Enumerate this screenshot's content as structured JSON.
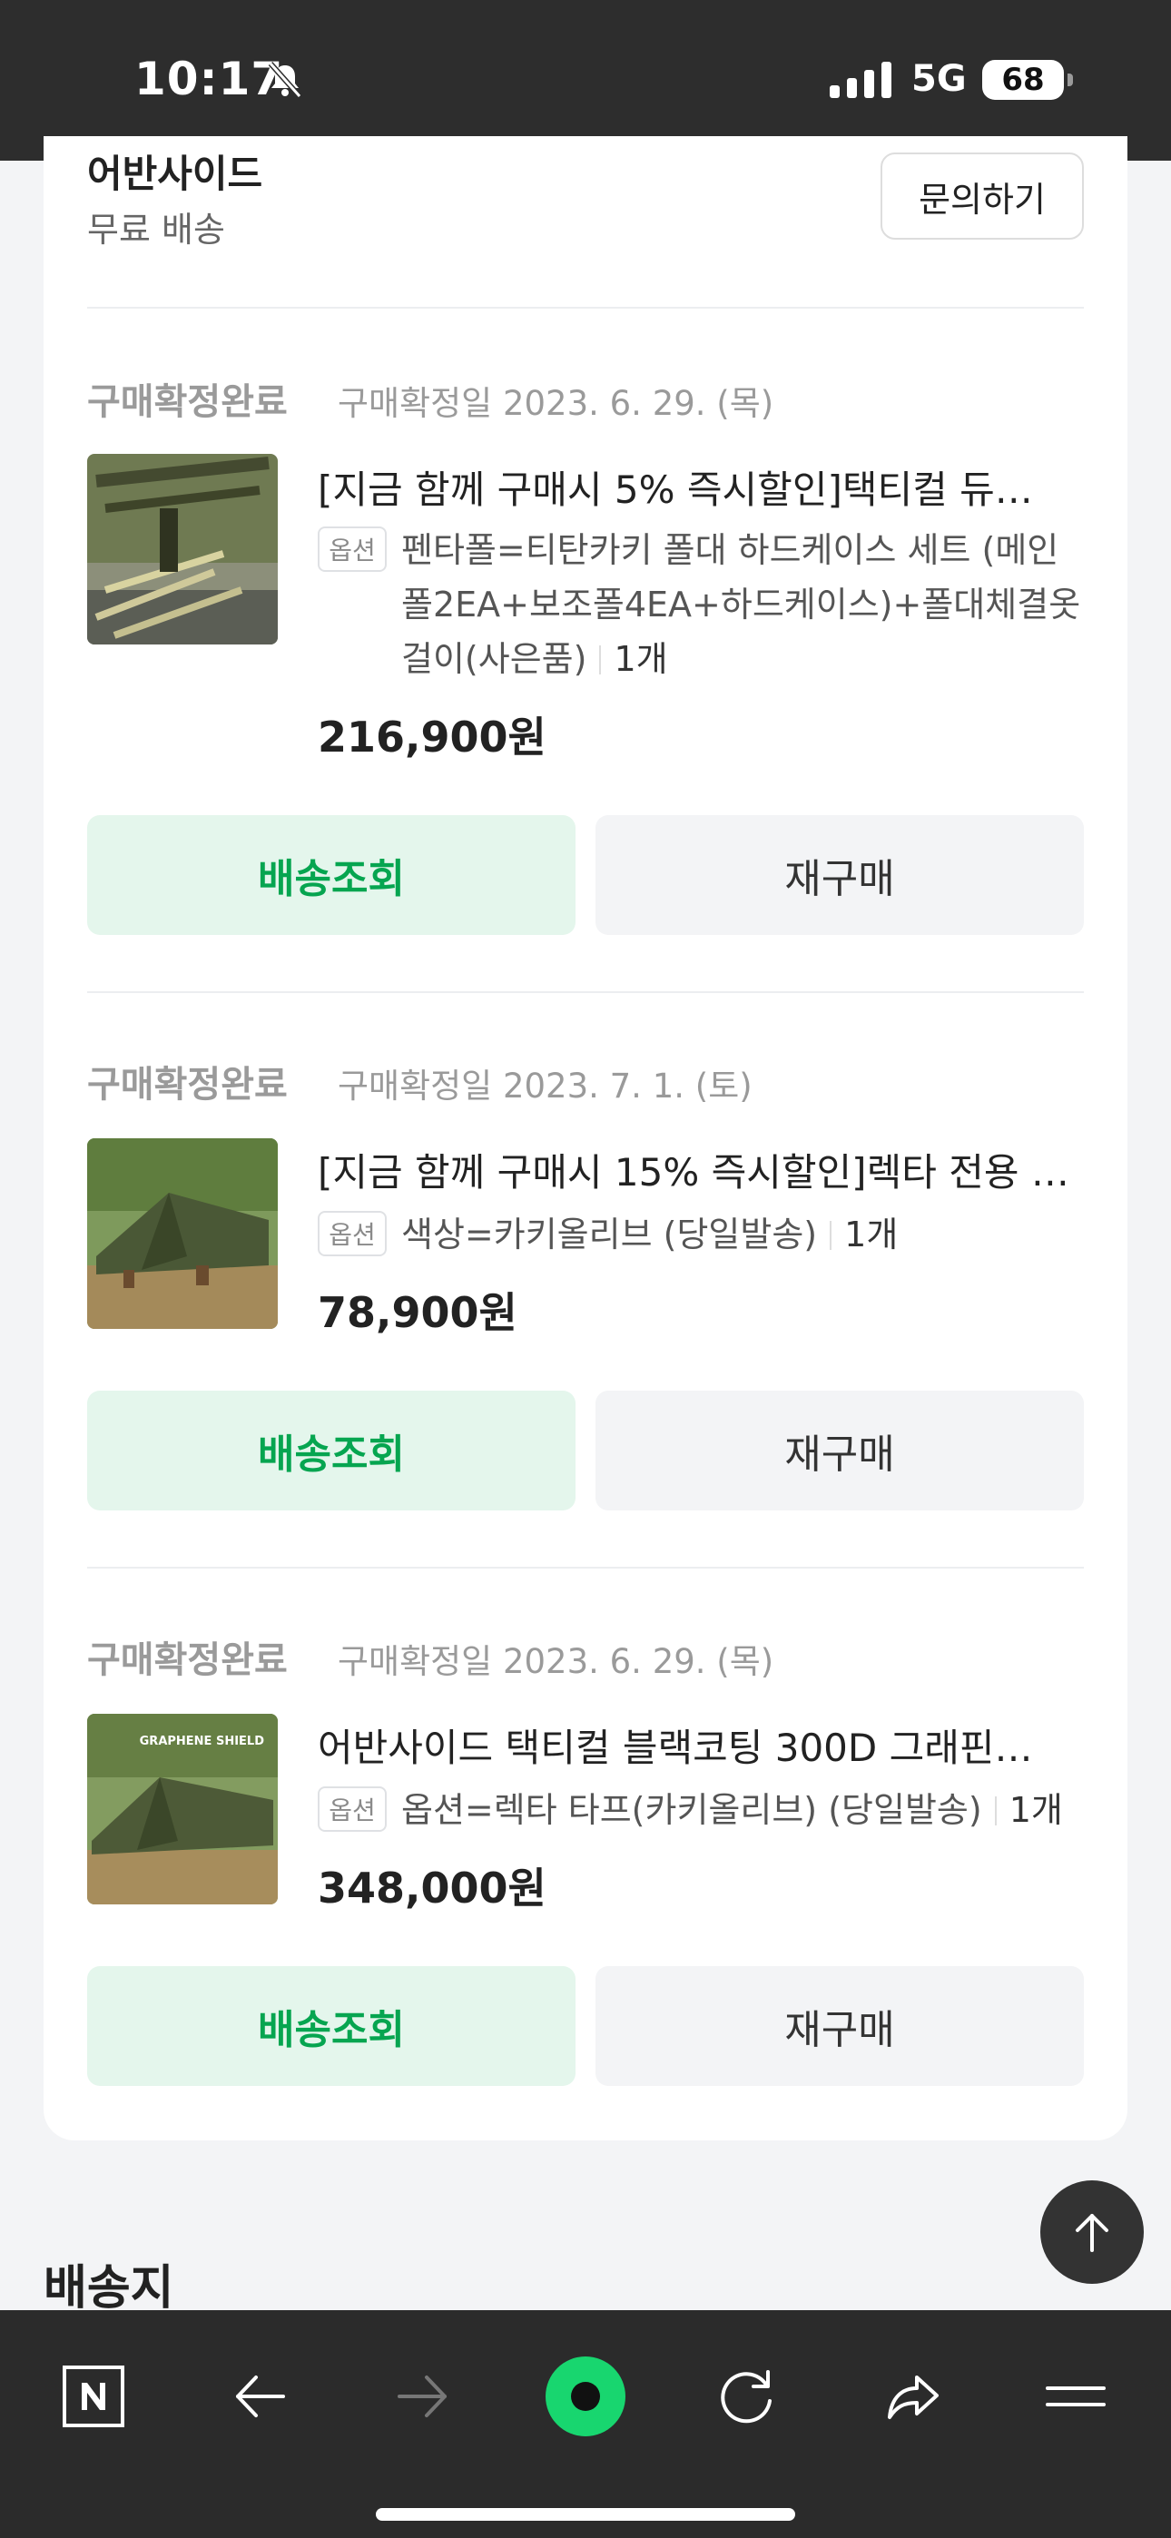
{
  "status_bar": {
    "time": "10:17",
    "network": "5G",
    "battery": "68"
  },
  "seller": {
    "name": "어반사이드",
    "shipping": "무료 배송",
    "inquiry_label": "문의하기"
  },
  "orders": [
    {
      "status": "구매확정완료",
      "date": "구매확정일 2023. 6. 29. (목)",
      "title": "[지금 함께 구매시 5% 즉시할인]택티컬 듀…",
      "option_badge": "옵션",
      "option": "펜타폴=티탄카키 폴대 하드케이스 세트 (메인폴2EA+보조폴4EA+하드케이스)+폴대체결옷걸이(사은품)",
      "quantity": "1개",
      "price": "216,900원",
      "track_label": "배송조회",
      "rebuy_label": "재구매"
    },
    {
      "status": "구매확정완료",
      "date": "구매확정일 2023. 7. 1. (토)",
      "title": "[지금 함께 구매시 15% 즉시할인]렉타 전용 …",
      "option_badge": "옵션",
      "option": "색상=카키올리브 (당일발송)",
      "quantity": "1개",
      "price": "78,900원",
      "track_label": "배송조회",
      "rebuy_label": "재구매"
    },
    {
      "status": "구매확정완료",
      "date": "구매확정일 2023. 6. 29. (목)",
      "title": "어반사이드 택티컬 블랙코팅 300D 그래핀…",
      "option_badge": "옵션",
      "option": "옵션=렉타 타프(카키올리브) (당일발송)",
      "quantity": "1개",
      "price": "348,000원",
      "track_label": "배송조회",
      "rebuy_label": "재구매",
      "thumb_text": "GRAPHENE SHIELD"
    }
  ],
  "next_section": {
    "title": "배송지"
  },
  "colors": {
    "accent": "#06a550",
    "track_bg": "#e4f6ec",
    "status_bar": "#2d2d2d",
    "toolbar": "#2b2b2b",
    "browser_green": "#18d66f"
  },
  "icons": [
    "bell-slash-icon",
    "signal-icon",
    "scroll-top-icon",
    "naver-n-icon",
    "back-arrow-icon",
    "forward-arrow-icon",
    "green-dot-icon",
    "reload-icon",
    "share-icon",
    "menu-icon"
  ]
}
